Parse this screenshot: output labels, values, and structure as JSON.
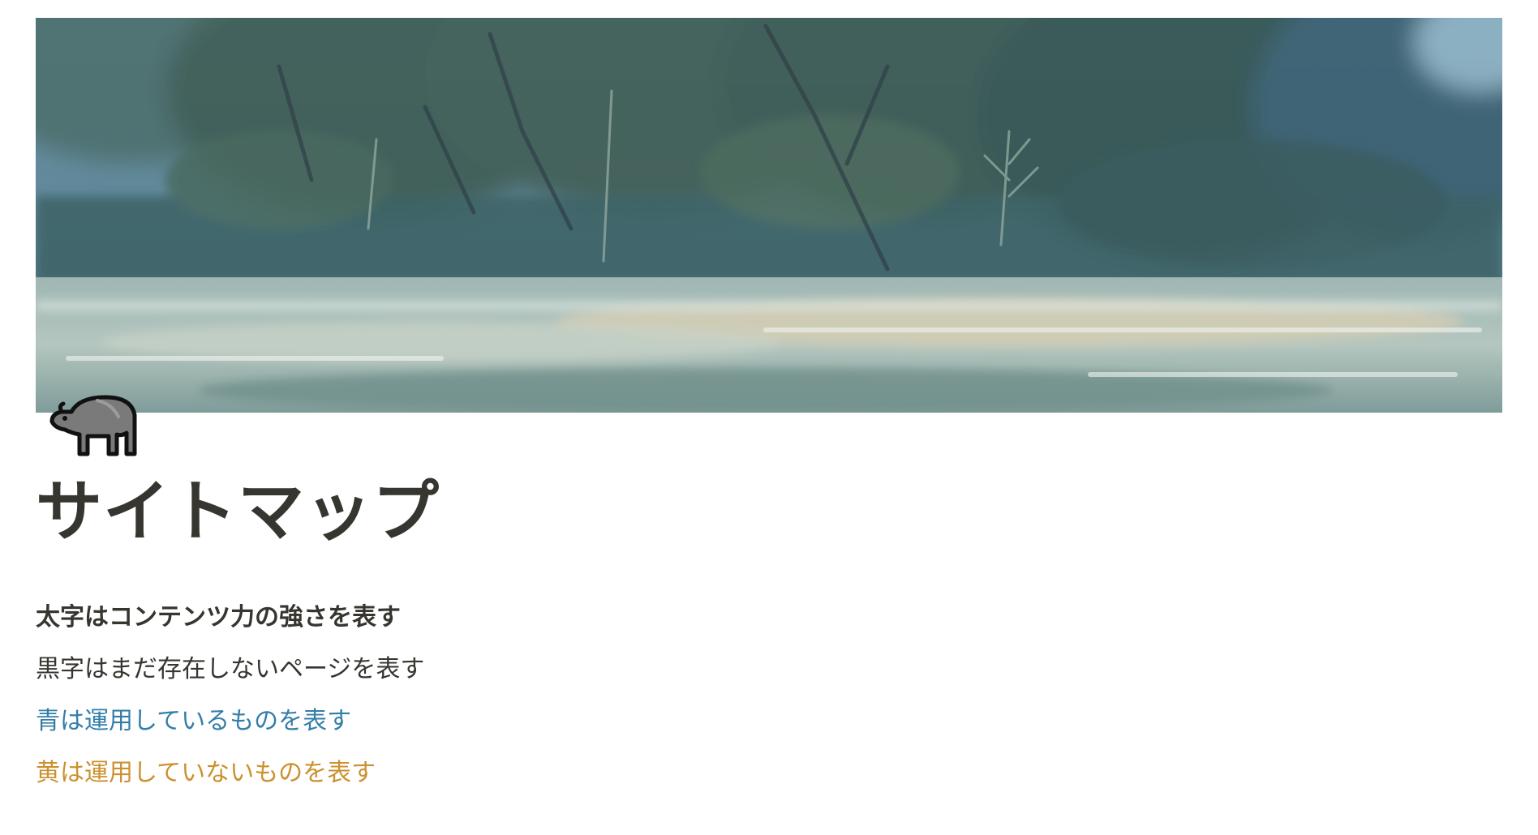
{
  "page": {
    "icon": "water-buffalo-icon",
    "title": "サイトマップ"
  },
  "legend": {
    "bold_line": "太字はコンテンツ力の強さを表す",
    "black_line": "黒字はまだ存在しないページを表す",
    "blue_line": "青は運用しているものを表す",
    "yellow_line": "黄は運用していないものを表す"
  },
  "colors": {
    "text": "#37352f",
    "blue": "#337ea9",
    "yellow": "#cb912f"
  }
}
